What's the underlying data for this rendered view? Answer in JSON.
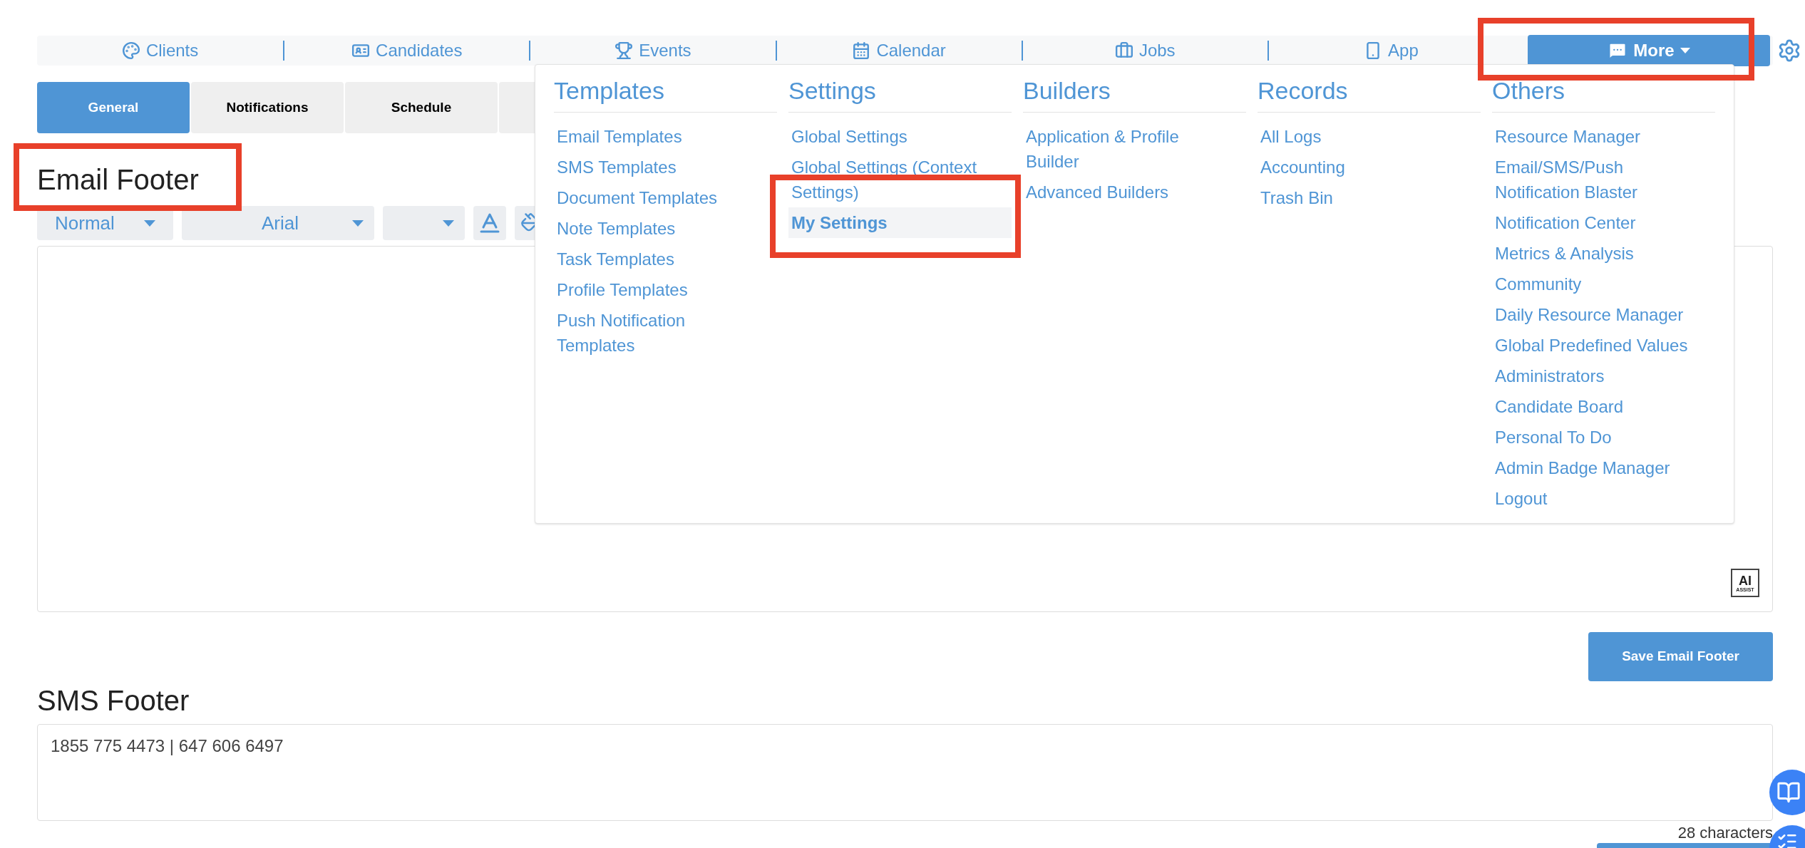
{
  "nav": {
    "items": [
      {
        "label": "Clients"
      },
      {
        "label": "Candidates"
      },
      {
        "label": "Events"
      },
      {
        "label": "Calendar"
      },
      {
        "label": "Jobs"
      },
      {
        "label": "App"
      }
    ],
    "more_button": {
      "label": "More",
      "expanded": true
    }
  },
  "tabs": [
    {
      "label": "General",
      "selected": true
    },
    {
      "label": "Notifications",
      "selected": false
    },
    {
      "label": "Schedule",
      "selected": false
    }
  ],
  "email_footer": {
    "title": "Email Footer",
    "toolbar": {
      "format": "Normal",
      "font": "Arial"
    },
    "ai_assist": {
      "title": "AI",
      "subtitle": "ASSIST"
    },
    "save_button": "Save Email Footer"
  },
  "sms_footer": {
    "title": "SMS Footer",
    "value": "1855 775 4473 | 647 606 6497",
    "counter": "28 characters"
  },
  "menu": {
    "columns": [
      {
        "title": "Templates",
        "items": [
          {
            "label": "Email Templates",
            "selected": false
          },
          {
            "label": "SMS Templates",
            "selected": false
          },
          {
            "label": "Document Templates",
            "selected": false
          },
          {
            "label": "Note Templates",
            "selected": false
          },
          {
            "label": "Task Templates",
            "selected": false
          },
          {
            "label": "Profile Templates",
            "selected": false
          },
          {
            "label": "Push Notification Templates",
            "selected": false
          }
        ]
      },
      {
        "title": "Settings",
        "items": [
          {
            "label": "Global Settings",
            "selected": false
          },
          {
            "label": "Global Settings (Context Settings)",
            "selected": false
          },
          {
            "label": "My Settings",
            "selected": true
          }
        ]
      },
      {
        "title": "Builders",
        "items": [
          {
            "label": "Application & Profile Builder",
            "selected": false
          },
          {
            "label": "Advanced Builders",
            "selected": false
          }
        ]
      },
      {
        "title": "Records",
        "items": [
          {
            "label": "All Logs",
            "selected": false
          },
          {
            "label": "Accounting",
            "selected": false
          },
          {
            "label": "Trash Bin",
            "selected": false
          }
        ]
      },
      {
        "title": "Others",
        "items": [
          {
            "label": "Resource Manager",
            "selected": false
          },
          {
            "label": "Email/SMS/Push Notification Blaster",
            "selected": false
          },
          {
            "label": "Notification Center",
            "selected": false
          },
          {
            "label": "Metrics & Analysis",
            "selected": false
          },
          {
            "label": "Community",
            "selected": false
          },
          {
            "label": "Daily Resource Manager",
            "selected": false
          },
          {
            "label": "Global Predefined Values",
            "selected": false
          },
          {
            "label": "Administrators",
            "selected": false
          },
          {
            "label": "Candidate Board",
            "selected": false
          },
          {
            "label": "Personal To Do",
            "selected": false
          },
          {
            "label": "Admin Badge Manager",
            "selected": false
          },
          {
            "label": "Logout",
            "selected": false
          }
        ]
      }
    ]
  }
}
